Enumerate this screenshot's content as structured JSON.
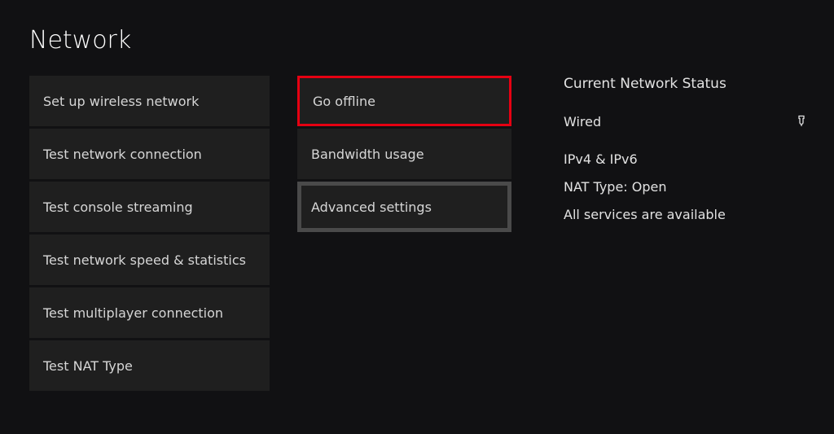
{
  "title": "Network",
  "col1": {
    "setup_wireless": "Set up wireless network",
    "test_connection": "Test network connection",
    "test_streaming": "Test console streaming",
    "test_speed": "Test network speed & statistics",
    "test_multiplayer": "Test multiplayer connection",
    "test_nat": "Test NAT Type"
  },
  "col2": {
    "go_offline": "Go offline",
    "bandwidth": "Bandwidth usage",
    "advanced": "Advanced settings"
  },
  "status": {
    "header": "Current Network Status",
    "connection_type": "Wired",
    "ip_versions": "IPv4 & IPv6",
    "nat_type": "NAT Type: Open",
    "services": "All services are available"
  },
  "icons": {
    "wired": "⏚"
  }
}
